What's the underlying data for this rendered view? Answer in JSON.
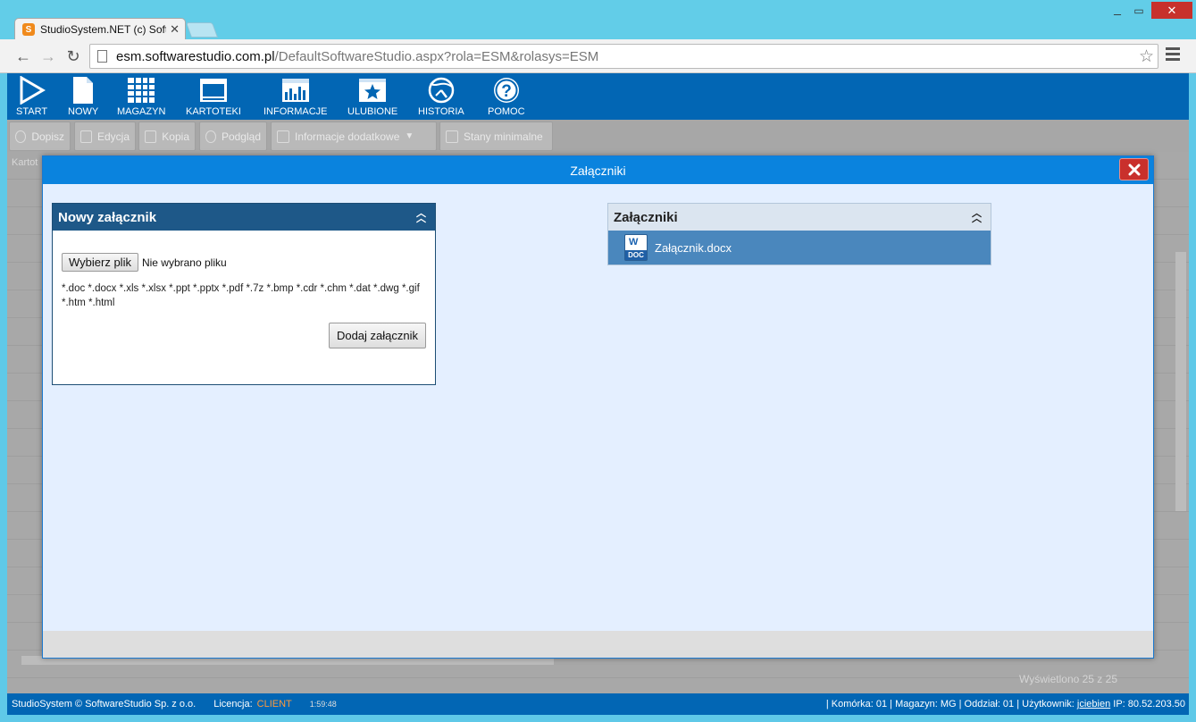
{
  "browser": {
    "tab_title": "StudioSystem.NET (c) Soft",
    "favicon_letter": "S",
    "url_host": "esm.softwarestudio.com.pl",
    "url_path": "/DefaultSoftwareStudio.aspx?rola=ESM&rolasys=ESM"
  },
  "app": {
    "main_menu": [
      {
        "label": "START",
        "icon": "play-icon"
      },
      {
        "label": "NOWY",
        "icon": "new-document-icon"
      },
      {
        "label": "MAGAZYN",
        "icon": "warehouse-grid-icon"
      },
      {
        "label": "KARTOTEKI",
        "icon": "card-window-icon"
      },
      {
        "label": "INFORMACJE",
        "icon": "bar-chart-icon"
      },
      {
        "label": "ULUBIONE",
        "icon": "star-icon"
      },
      {
        "label": "HISTORIA",
        "icon": "history-icon"
      },
      {
        "label": "POMOC",
        "icon": "help-icon"
      }
    ],
    "toolbar": {
      "add": "Dopisz",
      "edit": "Edycja",
      "copy": "Kopia",
      "preview": "Podgląd",
      "more_info": "Informacje dodatkowe",
      "min_stock": "Stany minimalne"
    },
    "background": {
      "breadcrumb": "Kartot",
      "status": "Wyświetlono 25 z 25"
    },
    "footer": {
      "copyright": "StudioSystem © SoftwareStudio Sp. z o.o.",
      "license_label": "Licencja:",
      "license_value": "CLIENT",
      "time": "1:59:48",
      "right_prefix": "| Komórka: 01 | Magazyn: MG | Oddział: 01 | Użytkownik:",
      "user": "jciebien",
      "ip": "IP: 80.52.203.50"
    }
  },
  "modal": {
    "title": "Załączniki",
    "new_attachment": {
      "header": "Nowy załącznik",
      "choose_file": "Wybierz plik",
      "no_file": "Nie wybrano pliku",
      "extensions": "*.doc *.docx *.xls *.xlsx *.ppt *.pptx *.pdf *.7z *.bmp *.cdr *.chm *.dat *.dwg *.gif *.htm *.html",
      "add_button": "Dodaj załącznik"
    },
    "attachments": {
      "header": "Załączniki",
      "items": [
        {
          "name": "Załącznik.docx",
          "icon_label": "DOC",
          "icon_letter": "W"
        }
      ]
    }
  }
}
